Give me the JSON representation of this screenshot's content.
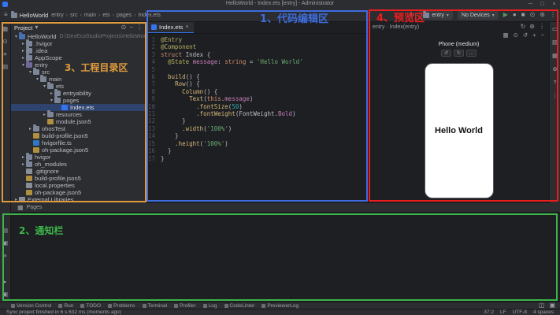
{
  "title_bar": {
    "title": "HelloWorld - Index.ets [entry] - Administrator",
    "window_controls": [
      {
        "name": "minimize",
        "glyph": "─"
      },
      {
        "name": "maximize",
        "glyph": "□"
      },
      {
        "name": "close",
        "glyph": "×"
      }
    ]
  },
  "toolbar": {
    "menu_glyph": "≡",
    "project_name": "HelloWorld",
    "breadcrumbs": [
      "entry",
      "src",
      "main",
      "ets",
      "pages",
      "Index.ets"
    ],
    "sync_icon": {
      "name": "sync",
      "glyph": "↻"
    },
    "run_config": "entry",
    "device": "No Devices",
    "right_icons": [
      {
        "name": "run",
        "glyph": "▶",
        "color": "#57965c"
      },
      {
        "name": "debug",
        "glyph": "●",
        "color": "#9da0a8"
      },
      {
        "name": "stop",
        "glyph": "■",
        "color": "#9da0a8"
      },
      {
        "name": "locate",
        "glyph": "⊙",
        "color": "#9da0a8"
      },
      {
        "name": "settings",
        "glyph": "⊛",
        "color": "#9da0a8"
      },
      {
        "name": "more",
        "glyph": "⋮",
        "color": "#9da0a8"
      }
    ]
  },
  "left_strip": {
    "top_icons": [
      {
        "name": "project",
        "glyph": "▦"
      },
      {
        "name": "commit",
        "glyph": "⊙"
      },
      {
        "name": "structure",
        "glyph": "≡"
      },
      {
        "name": "bookmarks",
        "glyph": "▤"
      }
    ],
    "mid_icons": [
      {
        "name": "notifications",
        "glyph": "▤"
      },
      {
        "name": "todo",
        "glyph": "▣"
      },
      {
        "name": "event-log",
        "glyph": "≡"
      }
    ],
    "bottom_icons": [
      {
        "name": "terminal",
        "glyph": "▸"
      },
      {
        "name": "problems",
        "glyph": "▣"
      }
    ]
  },
  "project_panel": {
    "title": "Project",
    "title_chevron": "▾",
    "header_icons": [
      {
        "name": "locate-file",
        "glyph": "⊙"
      },
      {
        "name": "collapse-all",
        "glyph": "−"
      },
      {
        "name": "more-options",
        "glyph": "⋮"
      }
    ],
    "tree": [
      {
        "label": "HelloWorld",
        "suffix": "D:\\DevEcoStudioProjects\\HelloWorld",
        "depth": 0,
        "chev": "v",
        "icon": "project"
      },
      {
        "label": ".hvigor",
        "depth": 1,
        "chev": ">",
        "icon": "folder"
      },
      {
        "label": ".idea",
        "depth": 1,
        "chev": ">",
        "icon": "folder"
      },
      {
        "label": "AppScope",
        "depth": 1,
        "chev": ">",
        "icon": "folder"
      },
      {
        "label": "entry",
        "depth": 1,
        "chev": "v",
        "icon": "module"
      },
      {
        "label": "src",
        "depth": 2,
        "chev": "v",
        "icon": "folder"
      },
      {
        "label": "main",
        "depth": 3,
        "chev": "v",
        "icon": "folder"
      },
      {
        "label": "ets",
        "depth": 4,
        "chev": "v",
        "icon": "folder"
      },
      {
        "label": "entryability",
        "depth": 5,
        "chev": ">",
        "icon": "folder"
      },
      {
        "label": "pages",
        "depth": 5,
        "chev": "v",
        "icon": "folder"
      },
      {
        "label": "Index.ets",
        "depth": 6,
        "chev": "",
        "icon": "ets",
        "selected": true
      },
      {
        "label": "resources",
        "depth": 4,
        "chev": ">",
        "icon": "folder"
      },
      {
        "label": "module.json5",
        "depth": 4,
        "chev": "",
        "icon": "json"
      },
      {
        "label": "ohosTest",
        "depth": 2,
        "chev": ">",
        "icon": "folder"
      },
      {
        "label": "build-profile.json5",
        "depth": 2,
        "chev": "",
        "icon": "json"
      },
      {
        "label": "hvigorfile.ts",
        "depth": 2,
        "chev": "",
        "icon": "ts"
      },
      {
        "label": "oh-package.json5",
        "depth": 2,
        "chev": "",
        "icon": "json"
      },
      {
        "label": "hvigor",
        "depth": 1,
        "chev": ">",
        "icon": "folder"
      },
      {
        "label": "oh_modules",
        "depth": 1,
        "chev": ">",
        "icon": "folder"
      },
      {
        "label": ".gitignore",
        "depth": 1,
        "chev": "",
        "icon": "file"
      },
      {
        "label": "build-profile.json5",
        "depth": 1,
        "chev": "",
        "icon": "json"
      },
      {
        "label": "local.properties",
        "depth": 1,
        "chev": "",
        "icon": "file"
      },
      {
        "label": "oh-package.json5",
        "depth": 1,
        "chev": "",
        "icon": "json"
      },
      {
        "label": "External Libraries",
        "depth": 0,
        "chev": ">",
        "icon": "lib"
      }
    ]
  },
  "editor": {
    "tab_label": "Index.ets",
    "tab_close_glyph": "×",
    "lines": [
      [
        {
          "t": "@Entry",
          "c": "deco"
        }
      ],
      [
        {
          "t": "@Component",
          "c": "deco"
        }
      ],
      [
        {
          "t": "struct",
          "c": "kw"
        },
        {
          "t": " Index {",
          "c": "pl"
        }
      ],
      [
        {
          "t": "  ",
          "c": "pl"
        },
        {
          "t": "@State",
          "c": "deco"
        },
        {
          "t": " ",
          "c": "pl"
        },
        {
          "t": "message",
          "c": "prop"
        },
        {
          "t": ": ",
          "c": "pl"
        },
        {
          "t": "string",
          "c": "kw"
        },
        {
          "t": " = ",
          "c": "pl"
        },
        {
          "t": "'Hello World'",
          "c": "str"
        }
      ],
      [],
      [
        {
          "t": "  ",
          "c": "pl"
        },
        {
          "t": "build",
          "c": "fn"
        },
        {
          "t": "() {",
          "c": "pl"
        }
      ],
      [
        {
          "t": "    ",
          "c": "pl"
        },
        {
          "t": "Row",
          "c": "fn"
        },
        {
          "t": "() {",
          "c": "pl"
        }
      ],
      [
        {
          "t": "      ",
          "c": "pl"
        },
        {
          "t": "Column",
          "c": "fn"
        },
        {
          "t": "() {",
          "c": "pl"
        }
      ],
      [
        {
          "t": "        ",
          "c": "pl"
        },
        {
          "t": "Text",
          "c": "fn"
        },
        {
          "t": "(",
          "c": "pl"
        },
        {
          "t": "this",
          "c": "kw"
        },
        {
          "t": ".",
          "c": "pl"
        },
        {
          "t": "message",
          "c": "prop"
        },
        {
          "t": ")",
          "c": "pl"
        }
      ],
      [
        {
          "t": "          .",
          "c": "pl"
        },
        {
          "t": "fontSize",
          "c": "fn"
        },
        {
          "t": "(",
          "c": "pl"
        },
        {
          "t": "50",
          "c": "num"
        },
        {
          "t": ")",
          "c": "pl"
        }
      ],
      [
        {
          "t": "          .",
          "c": "pl"
        },
        {
          "t": "fontWeight",
          "c": "fn"
        },
        {
          "t": "(FontWeight.",
          "c": "pl"
        },
        {
          "t": "Bold",
          "c": "prop"
        },
        {
          "t": ")",
          "c": "pl"
        }
      ],
      [
        {
          "t": "      }",
          "c": "pl"
        }
      ],
      [
        {
          "t": "      .",
          "c": "pl"
        },
        {
          "t": "width",
          "c": "fn"
        },
        {
          "t": "(",
          "c": "pl"
        },
        {
          "t": "'100%'",
          "c": "str"
        },
        {
          "t": ")",
          "c": "pl"
        }
      ],
      [
        {
          "t": "    }",
          "c": "pl"
        }
      ],
      [
        {
          "t": "    .",
          "c": "pl"
        },
        {
          "t": "height",
          "c": "fn"
        },
        {
          "t": "(",
          "c": "pl"
        },
        {
          "t": "'100%'",
          "c": "str"
        },
        {
          "t": ")",
          "c": "pl"
        }
      ],
      [
        {
          "t": "  }",
          "c": "pl"
        }
      ],
      [
        {
          "t": "}",
          "c": "pl"
        }
      ]
    ]
  },
  "previewer": {
    "header_text": "entry · Index(entry)",
    "header_icons": [
      {
        "name": "refresh",
        "glyph": "↻"
      },
      {
        "name": "settings",
        "glyph": "⊛"
      },
      {
        "name": "more",
        "glyph": "⋮"
      }
    ],
    "toolbar_icons": [
      {
        "name": "multi-profile",
        "glyph": "▦"
      },
      {
        "name": "inspector",
        "glyph": "⊙"
      },
      {
        "name": "rotate",
        "glyph": "↺"
      },
      {
        "name": "zoom-in",
        "glyph": "+"
      },
      {
        "name": "zoom-out",
        "glyph": "−"
      }
    ],
    "device_label": "Phone (medium)",
    "device_buttons": [
      {
        "name": "rotate-left",
        "glyph": "↺"
      },
      {
        "name": "rotate-right",
        "glyph": "↻"
      },
      {
        "name": "more",
        "glyph": "…"
      }
    ],
    "phone_text": "Hello World",
    "side_icons": [
      {
        "name": "previewer-tab",
        "glyph": "▭"
      },
      {
        "name": "gallery",
        "glyph": "▤"
      },
      {
        "name": "components",
        "glyph": "▦"
      },
      {
        "name": "settings",
        "glyph": "⊛"
      },
      {
        "name": "help",
        "glyph": "?"
      },
      {
        "name": "more",
        "glyph": "⋮"
      }
    ]
  },
  "pages_bar": {
    "icon_glyph": "▦",
    "label": "Pages"
  },
  "status_bar": {
    "tools": [
      "Version Control",
      "Run",
      "TODO",
      "Problems",
      "Terminal",
      "Profiler",
      "Log",
      "CodeLinter",
      "PreviewerLog"
    ],
    "right_icons": [
      {
        "name": "layout",
        "glyph": "◫"
      },
      {
        "name": "notifications",
        "glyph": "▣"
      }
    ],
    "message": "Sync project finished in 6 s 632 ms (moments ago)",
    "right_items": [
      "37:2",
      "LF",
      "UTF-8",
      "4 spaces"
    ]
  },
  "annotations": [
    {
      "id": "editor",
      "label": "1、代码编辑区",
      "color": "#3e6de0"
    },
    {
      "id": "notification",
      "label": "2、通知栏",
      "color": "#3cb54a"
    },
    {
      "id": "project",
      "label": "3、工程目录区",
      "color": "#e09a3e"
    },
    {
      "id": "previewer",
      "label": "4、预览区",
      "color": "#ee1d1d"
    }
  ]
}
